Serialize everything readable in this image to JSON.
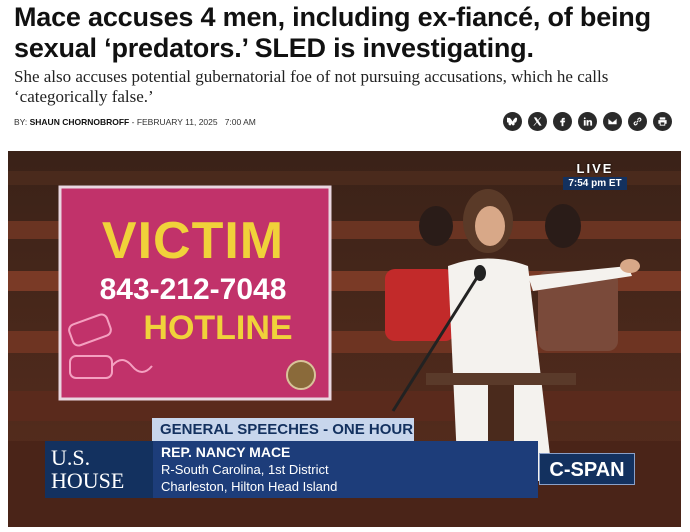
{
  "article": {
    "headline": "Mace accuses 4 men, including ex-fiancé, of being sexual ‘predators.’ SLED is investigating.",
    "dek": "She also accuses potential gubernatorial foe of not pursuing accusations, which he calls ‘categorically false.’",
    "byline_prefix": "BY:",
    "author": "SHAUN CHORNOBROFF",
    "separator": " - ",
    "date": "FEBRUARY 11, 2025",
    "time": "7:00 AM"
  },
  "share_icons": [
    "bluesky-icon",
    "x-icon",
    "facebook-icon",
    "linkedin-icon",
    "email-icon",
    "link-icon",
    "print-icon"
  ],
  "photo": {
    "live_label": "LIVE",
    "live_time": "7:54 pm ET",
    "sign": {
      "line1": "VICTIM",
      "line2": "843-212-7048",
      "line3": "HOTLINE"
    },
    "chyron": {
      "topic": "GENERAL SPEECHES - ONE HOUR",
      "house_line1": "U.S.",
      "house_line2": "HOUSE",
      "name": "REP. NANCY MACE",
      "district": "R-South Carolina, 1st District",
      "location": "Charleston, Hilton Head Island",
      "network": "C-SPAN"
    },
    "colors": {
      "sign_pink": "#c1326a",
      "sign_yellow": "#f0d23a",
      "chyron_navy": "#13315f",
      "chyron_blue": "#1d3d7a",
      "chyron_light": "#c8d6ec"
    }
  }
}
